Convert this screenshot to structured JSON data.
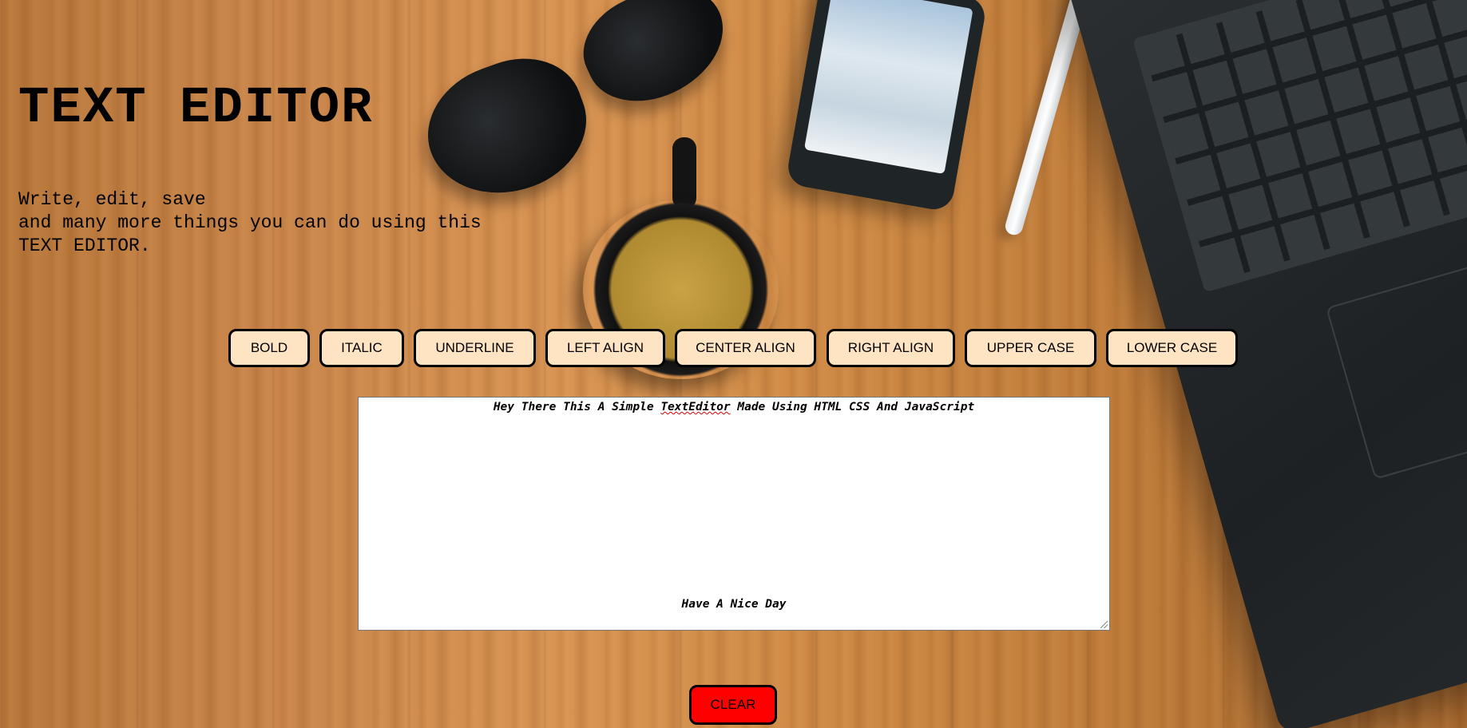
{
  "header": {
    "title": "TEXT EDITOR",
    "subtitle_lines": [
      "Write, edit, save",
      "and many more things you can do using this",
      "TEXT EDITOR."
    ]
  },
  "toolbar": {
    "buttons": [
      {
        "label": "BOLD"
      },
      {
        "label": "ITALIC"
      },
      {
        "label": "UNDERLINE"
      },
      {
        "label": "LEFT ALIGN"
      },
      {
        "label": "CENTER ALIGN"
      },
      {
        "label": "RIGHT ALIGN"
      },
      {
        "label": "UPPER CASE"
      },
      {
        "label": "LOWER CASE"
      }
    ]
  },
  "editor": {
    "line1_before": "Hey There This A Simple ",
    "line1_misspelled": "TextEditor",
    "line1_after": " Made Using HTML CSS And JavaScript",
    "line2": "Have A Nice Day"
  },
  "actions": {
    "clear_label": "CLEAR"
  },
  "colors": {
    "button_bg": "#ffe4c4",
    "clear_bg": "#ff0000"
  }
}
